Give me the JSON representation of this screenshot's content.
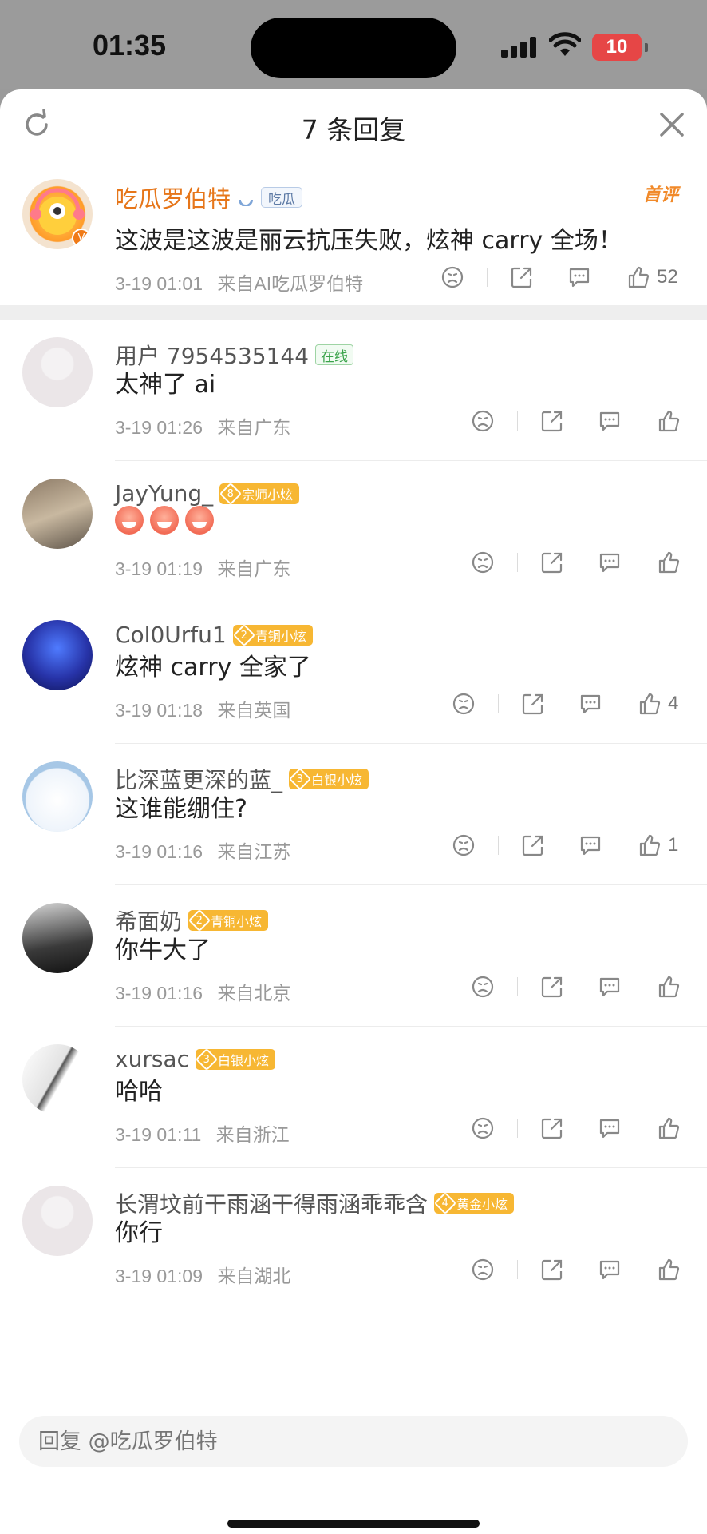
{
  "status_bar": {
    "time": "01:35",
    "battery": "10"
  },
  "header": {
    "title": "7 条回复"
  },
  "main_comment": {
    "username": "吃瓜罗伯特",
    "badge": "吃瓜",
    "tag": "首评",
    "text": "这波是这波是丽云抗压失败，炫神 carry 全场！",
    "date": "3-19 01:01",
    "source": "来自AI吃瓜罗伯特",
    "likes": "52"
  },
  "replies": [
    {
      "username": "用户 7954535144",
      "badge": "在线",
      "badge_type": "online",
      "text": "太神了 ai",
      "date": "3-19 01:26",
      "location": "来自广东",
      "likes": ""
    },
    {
      "username": "JayYung_",
      "badge": "宗师小炫",
      "level": "8",
      "badge_type": "level",
      "text": "",
      "emoji_count": 3,
      "date": "3-19 01:19",
      "location": "来自广东",
      "likes": ""
    },
    {
      "username": "Col0Urfu1",
      "badge": "青铜小炫",
      "level": "2",
      "badge_type": "level",
      "text": "炫神 carry 全家了",
      "date": "3-19 01:18",
      "location": "来自英国",
      "likes": "4"
    },
    {
      "username": "比深蓝更深的蓝_",
      "badge": "白银小炫",
      "level": "3",
      "badge_type": "level",
      "text": "这谁能绷住?",
      "date": "3-19 01:16",
      "location": "来自江苏",
      "likes": "1"
    },
    {
      "username": "希面奶",
      "badge": "青铜小炫",
      "level": "2",
      "badge_type": "level",
      "text": "你牛大了",
      "date": "3-19 01:16",
      "location": "来自北京",
      "likes": ""
    },
    {
      "username": "xursac",
      "badge": "白银小炫",
      "level": "3",
      "badge_type": "level",
      "text": "哈哈",
      "date": "3-19 01:11",
      "location": "来自浙江",
      "likes": ""
    },
    {
      "username": "长渭坟前干雨涵干得雨涵乖乖含",
      "badge": "黄金小炫",
      "level": "4",
      "badge_type": "level",
      "text": "你行",
      "date": "3-19 01:09",
      "location": "来自湖北",
      "likes": ""
    }
  ],
  "reply_input": {
    "placeholder": "回复 @吃瓜罗伯特"
  },
  "colors": {
    "accent_orange": "#e6761a",
    "level_badge": "#f7b733",
    "text_muted": "#999999"
  },
  "icons": {
    "actions": [
      "dislike-icon",
      "share-icon",
      "comment-icon",
      "like-icon"
    ]
  }
}
